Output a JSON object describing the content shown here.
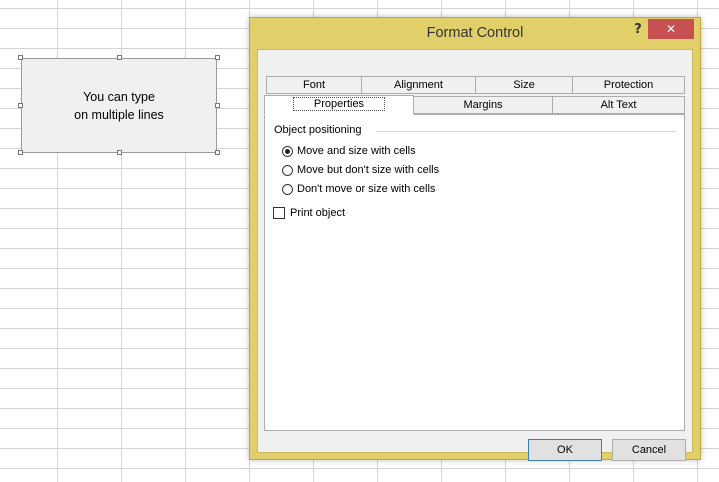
{
  "sheet": {
    "button_text": "You can type\non multiple lines"
  },
  "dialog": {
    "title": "Format Control",
    "help_glyph": "?",
    "close_glyph": "✕",
    "tabs_back": [
      "Font",
      "Alignment",
      "Size",
      "Protection"
    ],
    "tabs_front": [
      "Properties",
      "Margins",
      "Alt Text"
    ],
    "active_tab": "Properties",
    "properties": {
      "group_title": "Object positioning",
      "options": [
        {
          "label": "Move and size with cells",
          "checked": true
        },
        {
          "label": "Move but don't size with cells",
          "checked": false
        },
        {
          "label": "Don't move or size with cells",
          "checked": false
        }
      ],
      "print_object_label": "Print object",
      "print_object_checked": false
    },
    "ok_label": "OK",
    "cancel_label": "Cancel"
  },
  "colors": {
    "frame": "#e1cf6a",
    "close_button": "#c75050"
  }
}
